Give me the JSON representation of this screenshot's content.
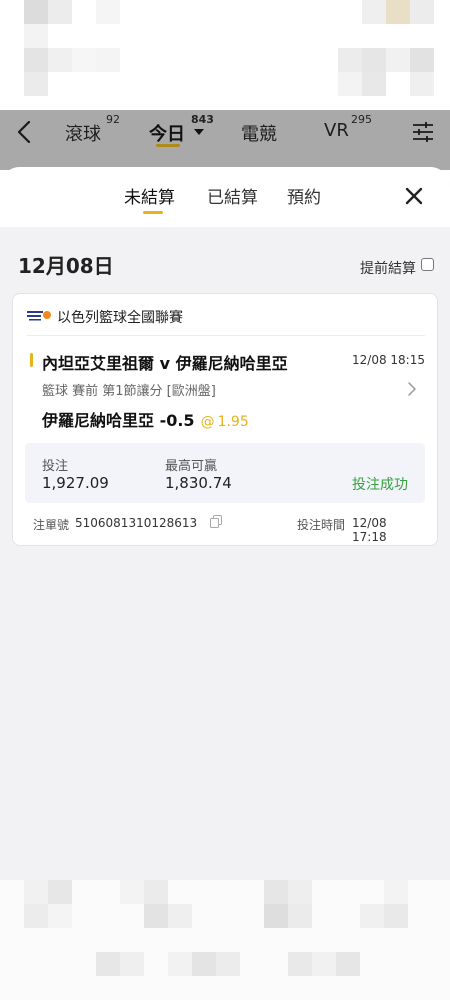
{
  "nav": {
    "tabs": [
      {
        "label": "滾球",
        "count": "92"
      },
      {
        "label": "今日",
        "count": "843"
      },
      {
        "label": "電競",
        "count": ""
      },
      {
        "label": "VR",
        "count": "295"
      }
    ],
    "back_icon": "chevron-left-icon",
    "filter_icon": "sliders-icon"
  },
  "sheet": {
    "tabs": [
      "未結算",
      "已結算",
      "預約"
    ],
    "active_tab": "未結算",
    "close_icon": "close-icon"
  },
  "date_row": {
    "date": "12月08日",
    "early_settle_label": "提前結算",
    "early_settle_checked": false
  },
  "bet": {
    "league": "以色列籃球全國聯賽",
    "match": "內坦亞艾里祖爾 v 伊羅尼納哈里亞",
    "match_time": "12/08 18:15",
    "market": "籃球 賽前   第1節讓分 [歐洲盤]",
    "pick": "伊羅尼納哈里亞 -0.5",
    "at": "@",
    "odds": "1.95",
    "stake_label": "投注",
    "stake_value": "1,927.09",
    "max_win_label": "最高可贏",
    "max_win_value": "1,830.74",
    "status": "投注成功",
    "ticket_label": "注單號",
    "ticket_no": "5106081310128613",
    "bet_time_label": "投注時間",
    "bet_time": "12/08 17:18"
  },
  "colors": {
    "accent": "#e8b21a",
    "nav_underline": "#b08a1a",
    "success": "#38a043",
    "nav_background": "#a9a9a9",
    "sheet_background": "#f2f2f4"
  }
}
